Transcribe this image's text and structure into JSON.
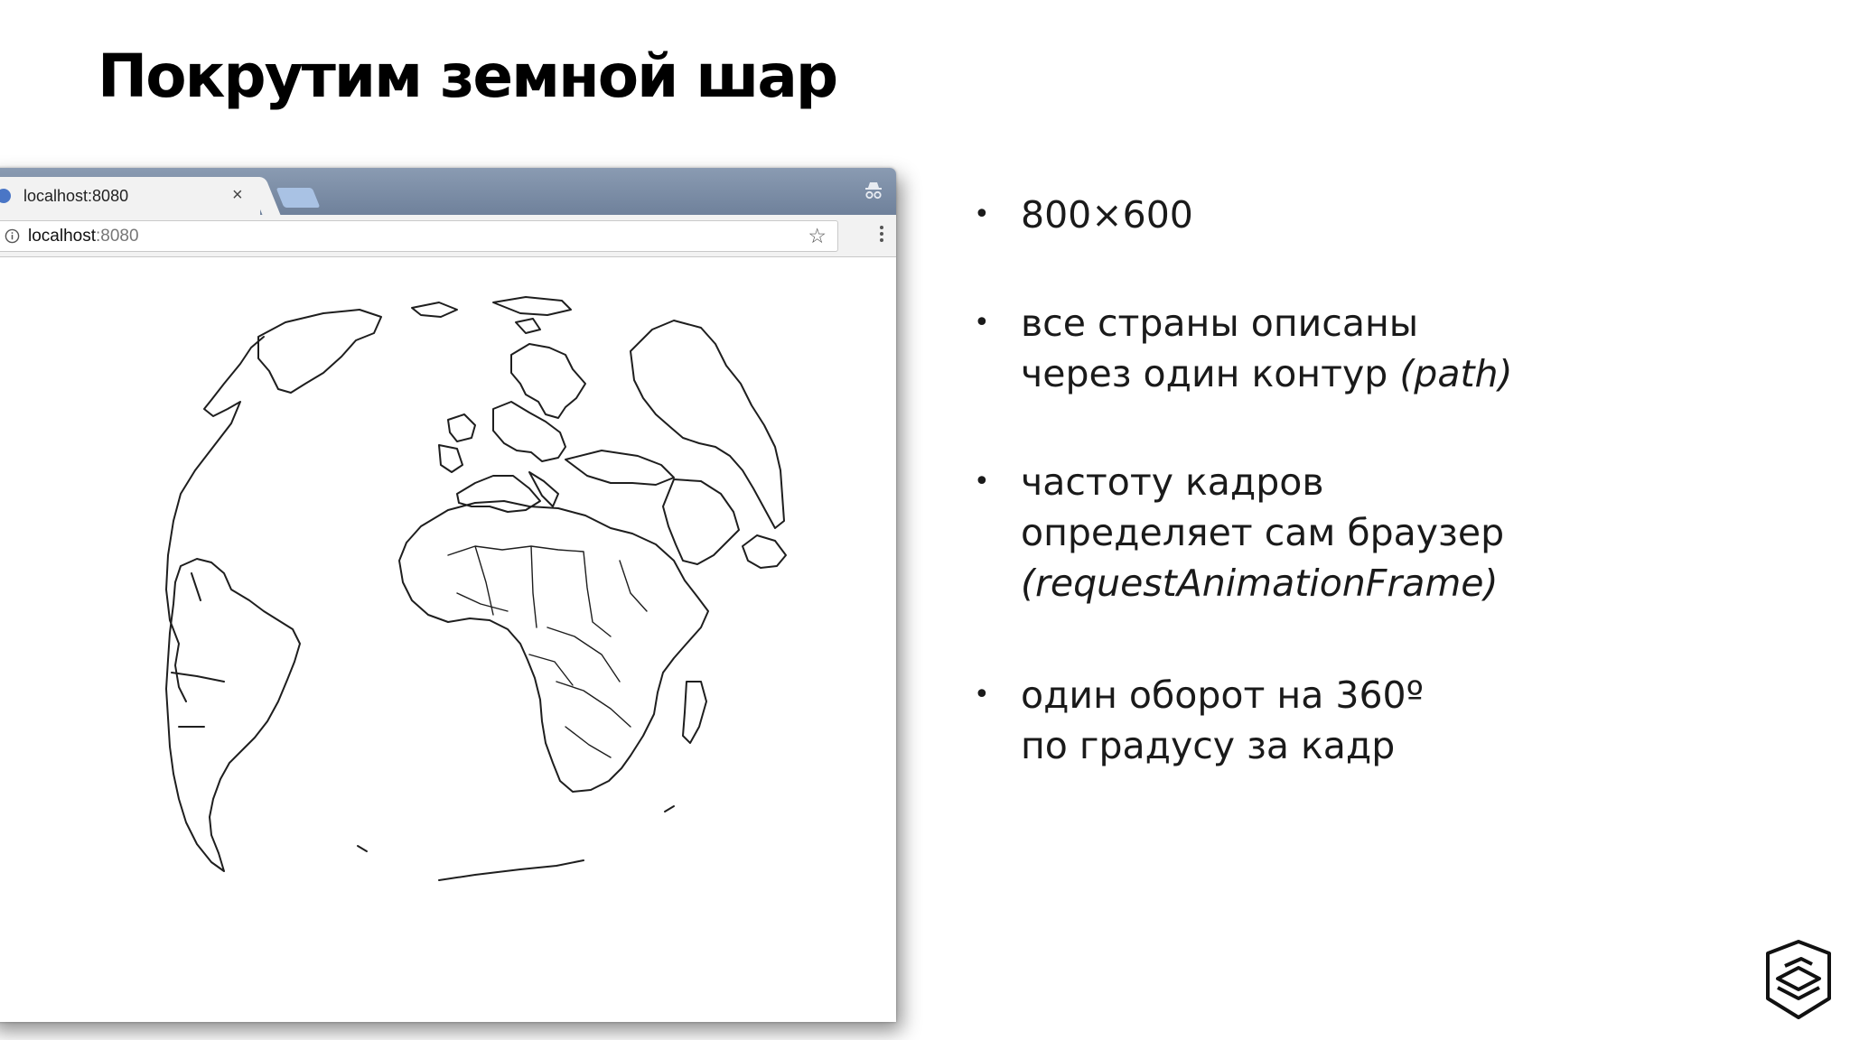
{
  "slide": {
    "title": "Покрутим земной шар"
  },
  "browser": {
    "tab": {
      "title": "localhost:8080",
      "close_glyph": "×",
      "favicon": "page-favicon"
    },
    "address_bar": {
      "host": "localhost",
      "port": ":8080",
      "info_icon": "info-icon",
      "bookmark_icon": "star-icon",
      "bookmark_glyph": "☆"
    },
    "window_icons": [
      "incognito-icon",
      "menu-icon"
    ],
    "accent_color": "#6f819b"
  },
  "bullets": [
    {
      "lines": [
        "800×600"
      ]
    },
    {
      "lines": [
        "все страны описаны",
        "через один контур "
      ],
      "italic": "(path)"
    },
    {
      "lines": [
        "частоту кадров",
        "определяет сам браузер"
      ],
      "italic": "(requestAnimationFrame)"
    },
    {
      "lines": [
        "один оборот на 360º",
        "по градусу за кадр"
      ]
    }
  ],
  "logo": {
    "icon": "logo-icon"
  }
}
